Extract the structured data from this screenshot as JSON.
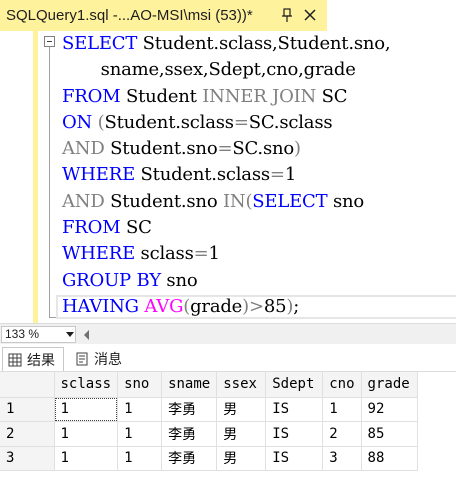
{
  "tab": {
    "title": "SQLQuery1.sql -...AO-MSI\\msi (53))*"
  },
  "editor": {
    "lines": [
      [
        {
          "t": "SELECT",
          "c": "kw"
        },
        {
          "t": " Student.sclass,Student.sno,",
          "c": ""
        }
      ],
      [
        {
          "t": "       sname,ssex,Sdept,cno,grade",
          "c": ""
        }
      ],
      [
        {
          "t": "FROM",
          "c": "kw"
        },
        {
          "t": " Student ",
          "c": ""
        },
        {
          "t": "INNER JOIN",
          "c": "gy"
        },
        {
          "t": " SC",
          "c": ""
        }
      ],
      [
        {
          "t": "ON",
          "c": "kw"
        },
        {
          "t": " ",
          "c": ""
        },
        {
          "t": "(",
          "c": "gy"
        },
        {
          "t": "Student.sclass",
          "c": ""
        },
        {
          "t": "=",
          "c": "gy"
        },
        {
          "t": "SC.sclass",
          "c": ""
        }
      ],
      [
        {
          "t": "AND",
          "c": "gy"
        },
        {
          "t": " Student.sno",
          "c": ""
        },
        {
          "t": "=",
          "c": "gy"
        },
        {
          "t": "SC.sno",
          "c": ""
        },
        {
          "t": ")",
          "c": "gy"
        }
      ],
      [
        {
          "t": "WHERE",
          "c": "kw"
        },
        {
          "t": " Student.sclass",
          "c": ""
        },
        {
          "t": "=",
          "c": "gy"
        },
        {
          "t": "1",
          "c": ""
        }
      ],
      [
        {
          "t": "AND",
          "c": "gy"
        },
        {
          "t": " Student.sno ",
          "c": ""
        },
        {
          "t": "IN",
          "c": "gy"
        },
        {
          "t": "(",
          "c": "gy"
        },
        {
          "t": "SELECT",
          "c": "kw"
        },
        {
          "t": " sno",
          "c": ""
        }
      ],
      [
        {
          "t": "FROM",
          "c": "kw"
        },
        {
          "t": " SC",
          "c": ""
        }
      ],
      [
        {
          "t": "WHERE",
          "c": "kw"
        },
        {
          "t": " sclass",
          "c": ""
        },
        {
          "t": "=",
          "c": "gy"
        },
        {
          "t": "1",
          "c": ""
        }
      ],
      [
        {
          "t": "GROUP BY",
          "c": "kw"
        },
        {
          "t": " sno",
          "c": ""
        }
      ],
      [
        {
          "t": "HAVING",
          "c": "kw"
        },
        {
          "t": " ",
          "c": ""
        },
        {
          "t": "AVG",
          "c": "fn"
        },
        {
          "t": "(",
          "c": "gy"
        },
        {
          "t": "grade",
          "c": ""
        },
        {
          "t": ")",
          "c": "gy"
        },
        {
          "t": ">",
          "c": "gy"
        },
        {
          "t": "85",
          "c": ""
        },
        {
          "t": ")",
          "c": "gy"
        },
        {
          "t": ";",
          "c": ""
        }
      ]
    ]
  },
  "zoom": {
    "value": "133 %"
  },
  "results_tabs": {
    "results_label": "结果",
    "messages_label": "消息"
  },
  "grid": {
    "columns": [
      "sclass",
      "sno",
      "sname",
      "ssex",
      "Sdept",
      "cno",
      "grade"
    ],
    "rows": [
      {
        "n": "1",
        "cells": [
          "1",
          "1",
          "李勇",
          "男",
          "IS",
          "1",
          "92"
        ]
      },
      {
        "n": "2",
        "cells": [
          "1",
          "1",
          "李勇",
          "男",
          "IS",
          "2",
          "85"
        ]
      },
      {
        "n": "3",
        "cells": [
          "1",
          "1",
          "李勇",
          "男",
          "IS",
          "3",
          "88"
        ]
      }
    ]
  },
  "colors": {
    "tab_accent": "#fff29d",
    "keyword": "#0000ff",
    "operator": "#808080",
    "function": "#ff00ff"
  },
  "icons": [
    "pin-icon",
    "close-icon",
    "collapse-icon",
    "grid-icon",
    "message-icon",
    "dropdown-icon",
    "scroll-left-icon"
  ]
}
